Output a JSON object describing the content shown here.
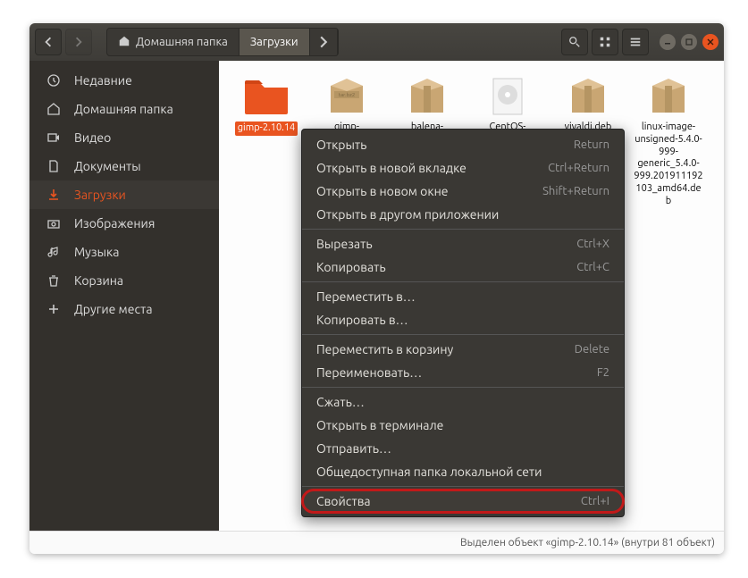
{
  "breadcrumb": {
    "home_label": "Домашняя папка",
    "current_label": "Загрузки"
  },
  "sidebar": {
    "items": [
      {
        "label": "Недавние"
      },
      {
        "label": "Домашняя папка"
      },
      {
        "label": "Видео"
      },
      {
        "label": "Документы"
      },
      {
        "label": "Загрузки"
      },
      {
        "label": "Изображения"
      },
      {
        "label": "Музыка"
      },
      {
        "label": "Корзина"
      },
      {
        "label": "Другие места"
      }
    ]
  },
  "files": [
    {
      "label": "gimp-2.10.14",
      "type": "folder",
      "selected": true
    },
    {
      "label": "gimp-",
      "badge": "tar.bz2",
      "type": "package"
    },
    {
      "label": "balena-",
      "type": "package"
    },
    {
      "label": "CentOS-",
      "type": "disc"
    },
    {
      "label": "vivaldi.deb",
      "type": "package"
    },
    {
      "label": "linux-image-unsigned-5.4.0-999-generic_5.4.0-999.201911192103_amd64.deb",
      "type": "package"
    }
  ],
  "context_menu": {
    "groups": [
      [
        {
          "label": "Открыть",
          "shortcut": "Return"
        },
        {
          "label": "Открыть в новой вкладке",
          "shortcut": "Ctrl+Return"
        },
        {
          "label": "Открыть в новом окне",
          "shortcut": "Shift+Return"
        },
        {
          "label": "Открыть в другом приложении",
          "shortcut": ""
        }
      ],
      [
        {
          "label": "Вырезать",
          "shortcut": "Ctrl+X"
        },
        {
          "label": "Копировать",
          "shortcut": "Ctrl+C"
        }
      ],
      [
        {
          "label": "Переместить в…",
          "shortcut": ""
        },
        {
          "label": "Копировать в…",
          "shortcut": ""
        }
      ],
      [
        {
          "label": "Переместить в корзину",
          "shortcut": "Delete"
        },
        {
          "label": "Переименовать…",
          "shortcut": "F2"
        }
      ],
      [
        {
          "label": "Сжать…",
          "shortcut": ""
        },
        {
          "label": "Открыть в терминале",
          "shortcut": ""
        },
        {
          "label": "Отправить…",
          "shortcut": ""
        },
        {
          "label": "Общедоступная папка локальной сети",
          "shortcut": ""
        }
      ],
      [
        {
          "label": "Свойства",
          "shortcut": "Ctrl+I",
          "highlighted": true
        }
      ]
    ]
  },
  "statusbar": {
    "text": "Выделен объект «gimp-2.10.14»  (внутри 81 объект)"
  }
}
